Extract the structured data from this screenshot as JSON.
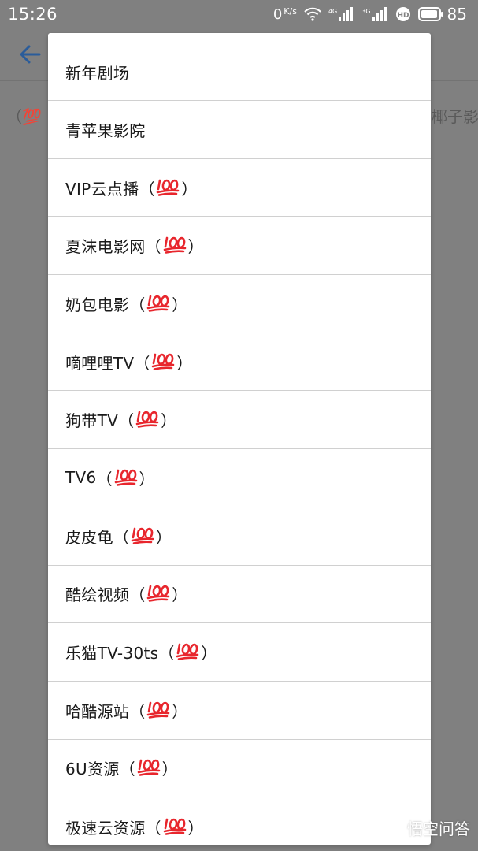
{
  "status_bar": {
    "time": "15:26",
    "net_speed_value": "0",
    "net_speed_unit": "K/s",
    "net_tag_1": "4G",
    "net_tag_2": "3G",
    "battery_level": "85"
  },
  "background": {
    "left_text": "（💯",
    "right_text": "椰子影"
  },
  "menu": {
    "items": [
      {
        "label": "新年剧场",
        "badge": false
      },
      {
        "label": "青苹果影院",
        "badge": false
      },
      {
        "label": "VIP云点播",
        "badge": true
      },
      {
        "label": "夏沫电影网",
        "badge": true
      },
      {
        "label": "奶包电影",
        "badge": true
      },
      {
        "label": "嘀哩哩TV",
        "badge": true
      },
      {
        "label": "狗带TV",
        "badge": true
      },
      {
        "label": "TV6",
        "badge": true
      },
      {
        "label": "皮皮龟",
        "badge": true
      },
      {
        "label": "酷绘视频",
        "badge": true
      },
      {
        "label": "乐猫TV-30ts",
        "badge": true
      },
      {
        "label": "哈酷源站",
        "badge": true
      },
      {
        "label": "6U资源",
        "badge": true
      },
      {
        "label": "极速云资源",
        "badge": true
      }
    ],
    "paren_open": "（",
    "paren_close": "）",
    "badge_icon": "hundred-points-icon",
    "badge_color": "#e8262d"
  },
  "watermark": {
    "text": "悟空问答"
  }
}
